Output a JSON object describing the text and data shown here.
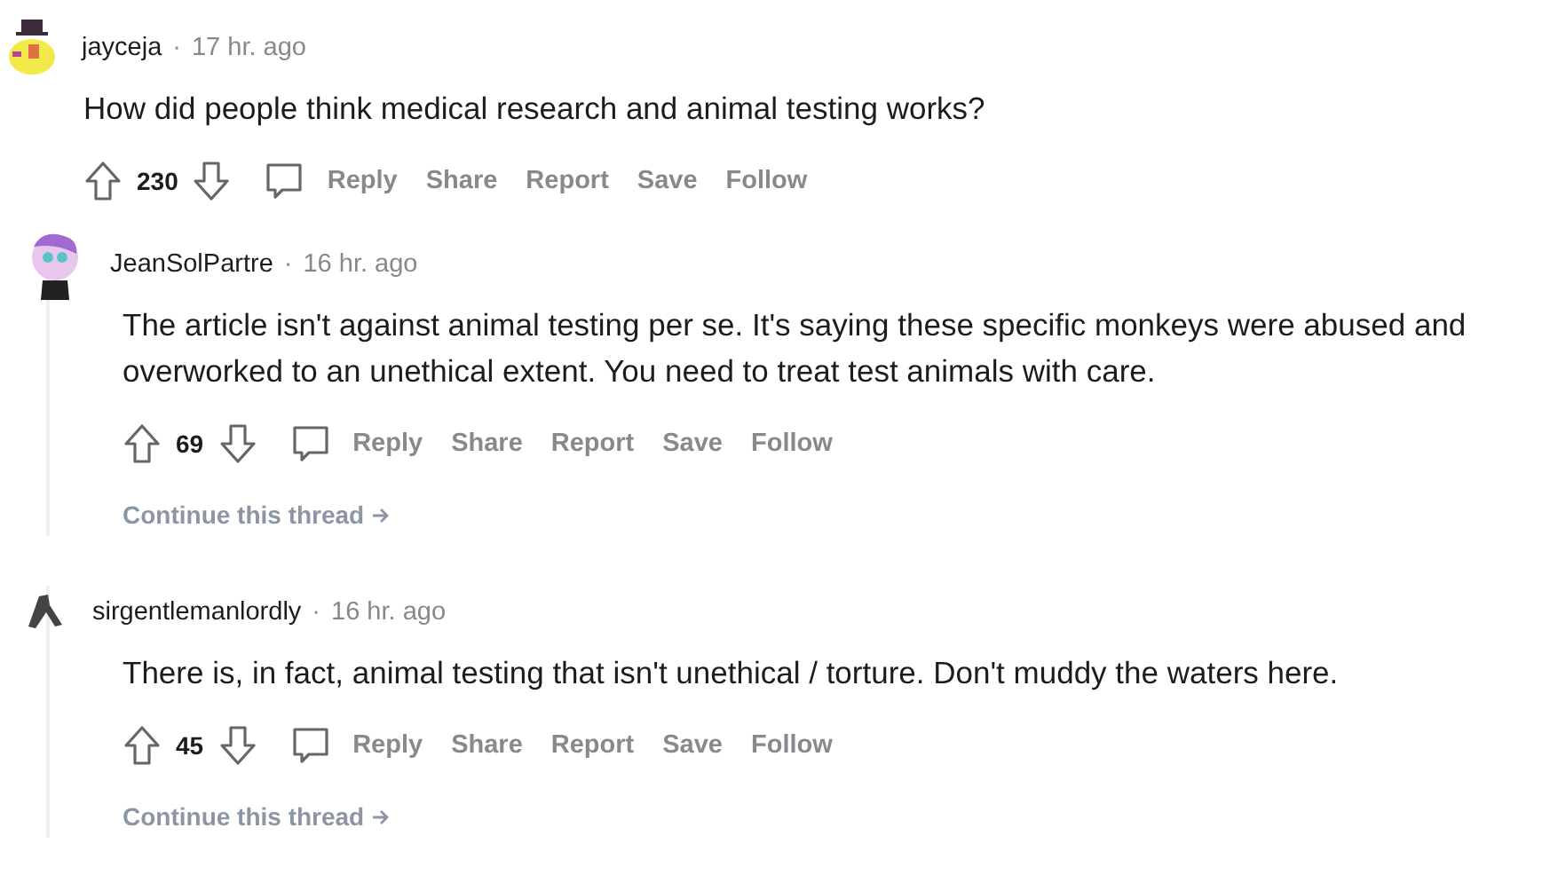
{
  "comments": [
    {
      "kind": "duck",
      "username": "jayceja",
      "separator": "·",
      "time": "17 hr. ago",
      "body": "How did people think medical research and animal testing works?",
      "score": "230",
      "actions": [
        "Reply",
        "Share",
        "Report",
        "Save",
        "Follow"
      ],
      "children": [
        {
          "kind": "cartoon",
          "username": "JeanSolPartre",
          "separator": "·",
          "time": "16 hr. ago",
          "body": "The article isn't against animal testing per se. It's saying these specific monkeys were abused and overworked to an unethical extent. You need to treat test animals with care.",
          "score": "69",
          "actions": [
            "Reply",
            "Share",
            "Report",
            "Save",
            "Follow"
          ],
          "continue": "Continue this thread"
        },
        {
          "kind": "figure",
          "username": "sirgentlemanlordly",
          "separator": "·",
          "time": "16 hr. ago",
          "body": "There is, in fact, animal testing that isn't unethical / torture. Don't muddy the waters here.",
          "score": "45",
          "actions": [
            "Reply",
            "Share",
            "Report",
            "Save",
            "Follow"
          ],
          "continue": "Continue this thread"
        }
      ]
    }
  ]
}
